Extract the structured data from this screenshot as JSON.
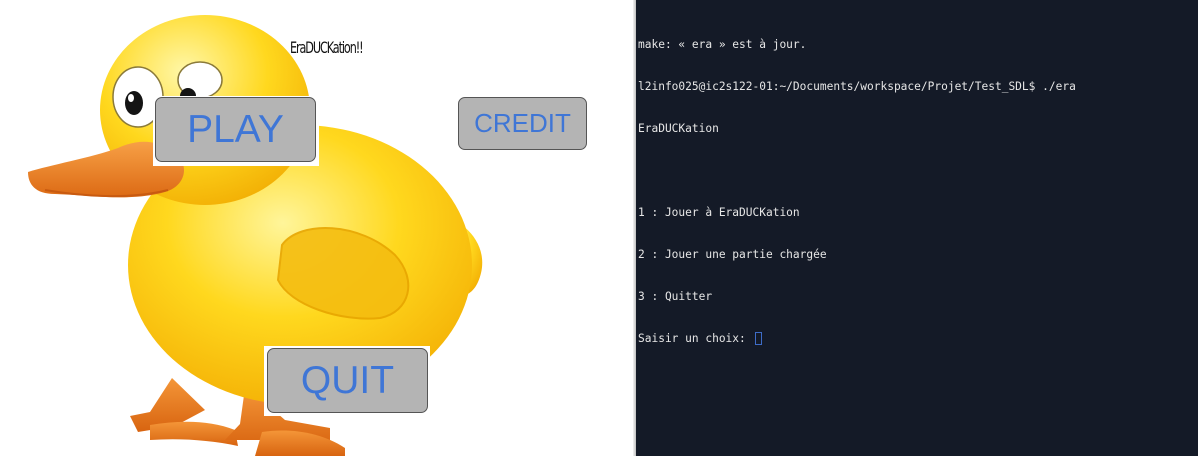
{
  "game": {
    "title": "EraDUCKation!!",
    "buttons": {
      "play": "PLAY",
      "credit": "CREDIT",
      "quit": "QUIT"
    },
    "colors": {
      "button_bg": "#b4b4b4",
      "button_text": "#3f76d6",
      "duck_body": "#ffd21f",
      "duck_beak": "#f08a2c"
    }
  },
  "terminal": {
    "lines": [
      "make: « era » est à jour.",
      "l2info025@ic2s122-01:~/Documents/workspace/Projet/Test_SDL$ ./era",
      "EraDUCKation",
      "",
      "1 : Jouer à EraDUCKation",
      "2 : Jouer une partie chargée",
      "3 : Quitter"
    ],
    "prompt": "Saisir un choix: ",
    "colors": {
      "background": "#141a27",
      "text": "#e6e6e6",
      "cursor": "#3e6cc7"
    }
  }
}
